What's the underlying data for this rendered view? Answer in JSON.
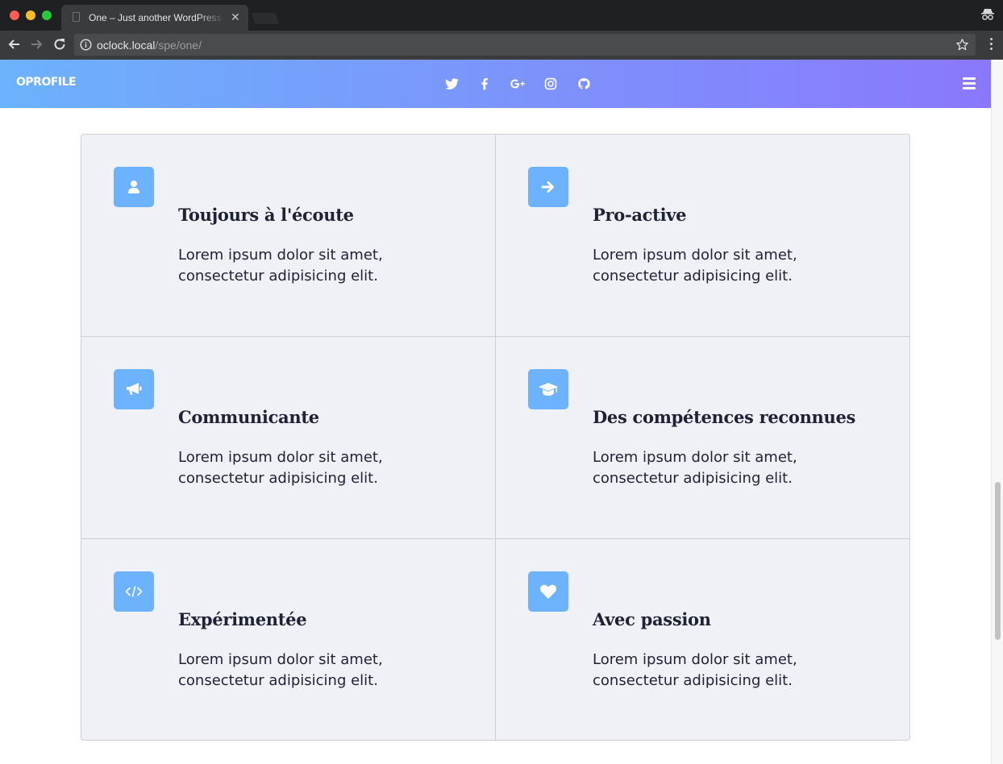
{
  "browser": {
    "tab_title": "One – Just another WordPress site",
    "tab_close": "✕",
    "url_host": "oclock.local",
    "url_path": "/spe/one/"
  },
  "site": {
    "brand": "OPROFILE",
    "social": [
      {
        "name": "twitter",
        "icon": "twitter-icon"
      },
      {
        "name": "facebook",
        "icon": "facebook-icon"
      },
      {
        "name": "google-plus",
        "icon": "google-plus-icon"
      },
      {
        "name": "instagram",
        "icon": "instagram-icon"
      },
      {
        "name": "github",
        "icon": "github-icon"
      }
    ],
    "accent_color": "#6cb2fc",
    "gradient": [
      "#6cb2fc",
      "#8a78fc"
    ]
  },
  "features": [
    {
      "title": "Toujours à l'écoute",
      "text": "Lorem ipsum dolor sit amet, consectetur adipisicing elit.",
      "icon": "user-icon"
    },
    {
      "title": "Pro-active",
      "text": "Lorem ipsum dolor sit amet, consectetur adipisicing elit.",
      "icon": "arrow-right-icon"
    },
    {
      "title": "Communicante",
      "text": "Lorem ipsum dolor sit amet, consectetur adipisicing elit.",
      "icon": "bullhorn-icon"
    },
    {
      "title": "Des compétences reconnues",
      "text": "Lorem ipsum dolor sit amet, consectetur adipisicing elit.",
      "icon": "graduation-cap-icon"
    },
    {
      "title": "Expérimentée",
      "text": "Lorem ipsum dolor sit amet, consectetur adipisicing elit.",
      "icon": "code-icon"
    },
    {
      "title": "Avec passion",
      "text": "Lorem ipsum dolor sit amet, consectetur adipisicing elit.",
      "icon": "heart-icon"
    }
  ]
}
